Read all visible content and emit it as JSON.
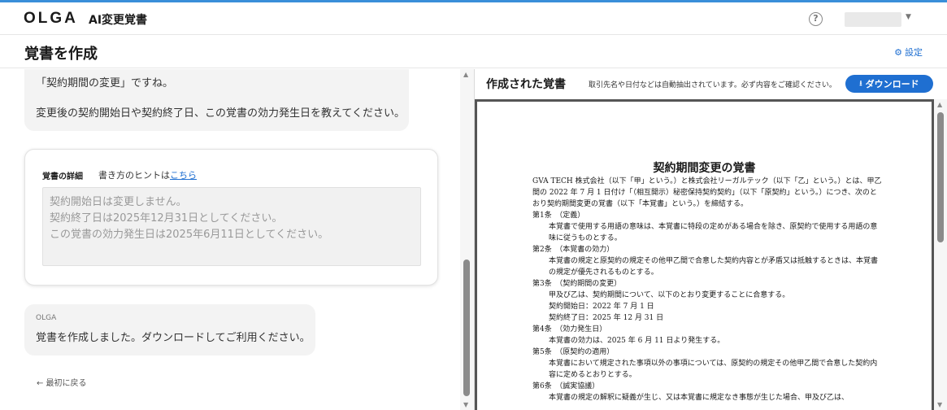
{
  "header": {
    "logo": "OLGA",
    "app_name": "AI変更覚書",
    "help_glyph": "?"
  },
  "titlebar": {
    "title": "覚書を作成",
    "settings_label": "設定"
  },
  "chat": {
    "bubble1": {
      "line1": "「契約期間の変更」ですね。",
      "line2": "変更後の契約開始日や契約終了日、この覚書の効力発生日を教えてください。"
    },
    "detail": {
      "label": "覚書の詳細",
      "hint_prefix": "書き方のヒントは",
      "hint_link": "こちら",
      "value": "契約開始日は変更しません。\n契約終了日は2025年12月31日としてください。\nこの覚書の効力発生日は2025年6月11日としてください。"
    },
    "bubble2": {
      "from": "OLGA",
      "message": "覚書を作成しました。ダウンロードしてご利用ください。"
    },
    "back_link": "← 最初に戻る"
  },
  "preview": {
    "title": "作成された覚書",
    "note": "取引先名や日付などは自動抽出されています。必ず内容をご確認ください。",
    "download_label": "ダウンロード",
    "doc": {
      "title": "契約期間変更の覚書",
      "intro": "GVA TECH 株式会社（以下「甲」という。）と株式会社リーガルテック（以下「乙」という。）とは、甲乙間の 2022 年 7 月 1 日付け「（相互開示）秘密保持契約契約」（以下「原契約」という。）につき、次のとおり契約期間変更の覚書（以下「本覚書」という。）を締結する。",
      "a1_h": "第1条　（定義）",
      "a1_b": "本覚書で使用する用語の意味は、本覚書に特段の定めがある場合を除き、原契約で使用する用語の意味に従うものとする。",
      "a2_h": "第2条　（本覚書の効力）",
      "a2_b": "本覚書の規定と原契約の規定その他甲乙間で合意した契約内容とが矛盾又は抵触するときは、本覚書の規定が優先されるものとする。",
      "a3_h": "第3条　（契約期間の変更）",
      "a3_b": "甲及び乙は、契約期間について、以下のとおり変更することに合意する。",
      "a3_start": "契約開始日：2022 年 7 月 1 日",
      "a3_end": "契約終了日：2025 年 12 月 31 日",
      "a4_h": "第4条　（効力発生日）",
      "a4_b": "本覚書の効力は、2025 年 6 月 11 日より発生する。",
      "a5_h": "第5条　（原契約の適用）",
      "a5_b": "本覚書において規定された事項以外の事項については、原契約の規定その他甲乙間で合意した契約内容に定めるとおりとする。",
      "a6_h": "第6条　（誠実協議）",
      "a6_b": "本覚書の規定の解釈に疑義が生じ、又は本覚書に規定なき事態が生じた場合、甲及び乙は、"
    }
  }
}
